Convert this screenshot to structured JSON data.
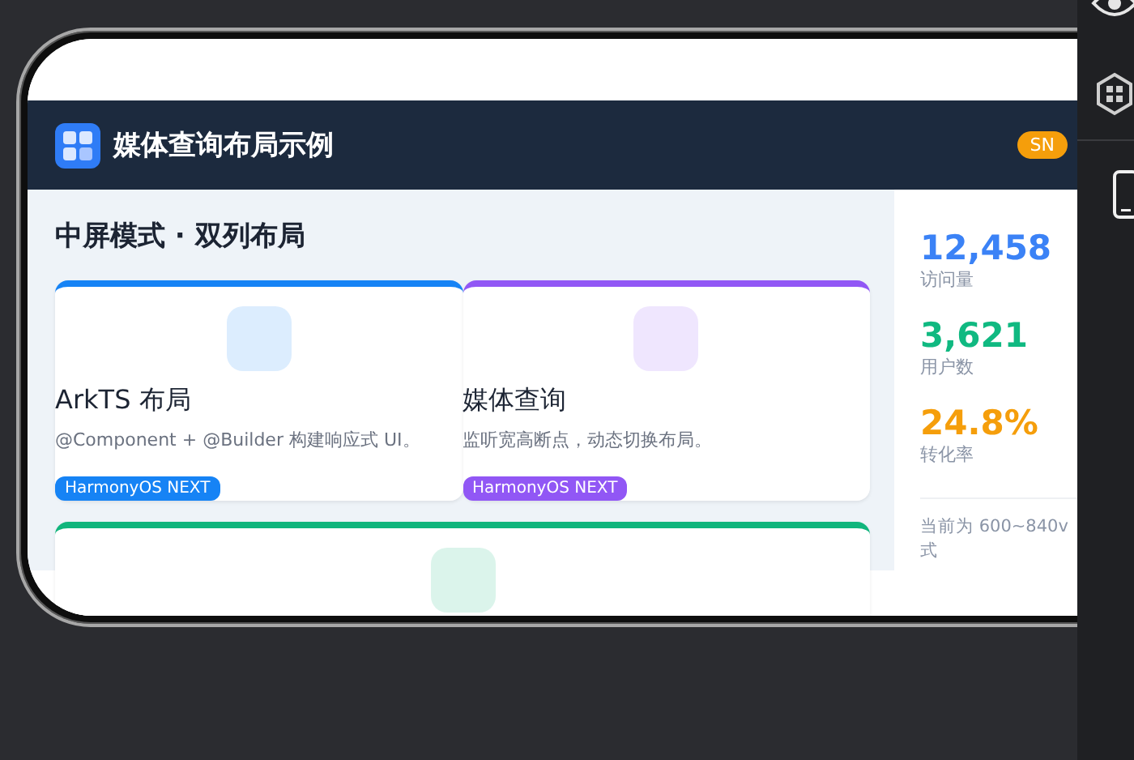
{
  "app_bar": {
    "title": "媒体查询布局示例",
    "badge": "SN"
  },
  "main": {
    "heading": "中屏模式 · 双列布局",
    "cards": [
      {
        "title": "ArkTS 布局",
        "description": "@Component + @Builder 构建响应式 UI。",
        "tag": "HarmonyOS NEXT",
        "color": "#1683f5"
      },
      {
        "title": "媒体查询",
        "description": "监听宽高断点，动态切换布局。",
        "tag": "HarmonyOS NEXT",
        "color": "#9157f5"
      },
      {
        "color": "#10b57c"
      }
    ]
  },
  "stats": {
    "items": [
      {
        "value": "12,458",
        "label": "访问量",
        "color": "#3b82f6"
      },
      {
        "value": "3,621",
        "label": "用户数",
        "color": "#10b981"
      },
      {
        "value": "24.8%",
        "label": "转化率",
        "color": "#f59e0b"
      }
    ],
    "caption_lines": [
      "当前为 600~840v",
      "式"
    ]
  }
}
